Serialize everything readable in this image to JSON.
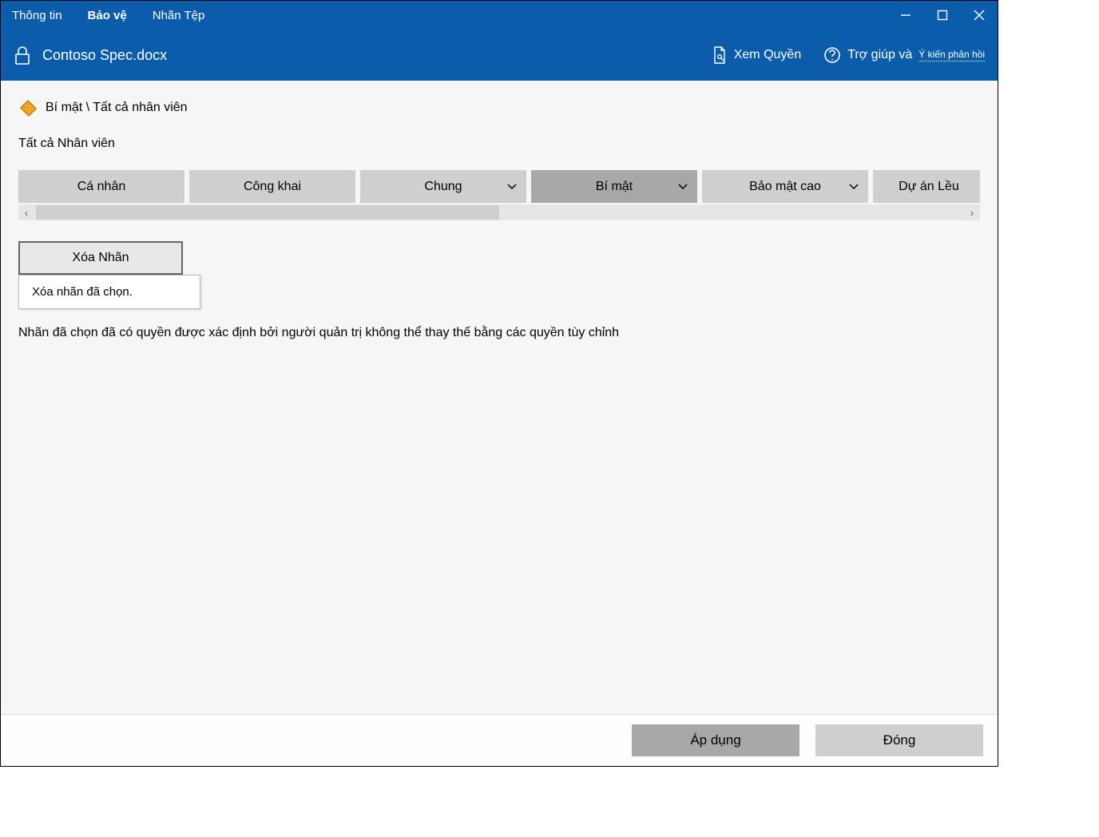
{
  "tabs": {
    "info": "Thông tin",
    "protect": "Bảo vệ",
    "file_label": "Nhãn Tệp"
  },
  "file": {
    "title": "Contoso Spec.docx"
  },
  "header_links": {
    "view_rights": "Xem Quyền",
    "help_and": "Trợ giúp và",
    "feedback": "Ý kiến phản hồi"
  },
  "current_label": {
    "path": "Bí mật \\ Tất cả nhân viên"
  },
  "subheading": "Tất cả Nhân viên",
  "label_options": {
    "personal": "Cá nhân",
    "public": "Công khai",
    "general": "Chung",
    "confidential": "Bí mật",
    "highly_confidential": "Bảo mật cao",
    "project_tent": "Dự án Lều"
  },
  "delete_label": {
    "button": "Xóa Nhãn",
    "tooltip": "Xóa nhãn đã chọn."
  },
  "description": "Nhãn đã chọn đã có quyền được xác định bởi người quản trị không thể thay thế bằng các quyền tùy chỉnh",
  "footer": {
    "apply": "Áp dụng",
    "close": "Đóng"
  }
}
